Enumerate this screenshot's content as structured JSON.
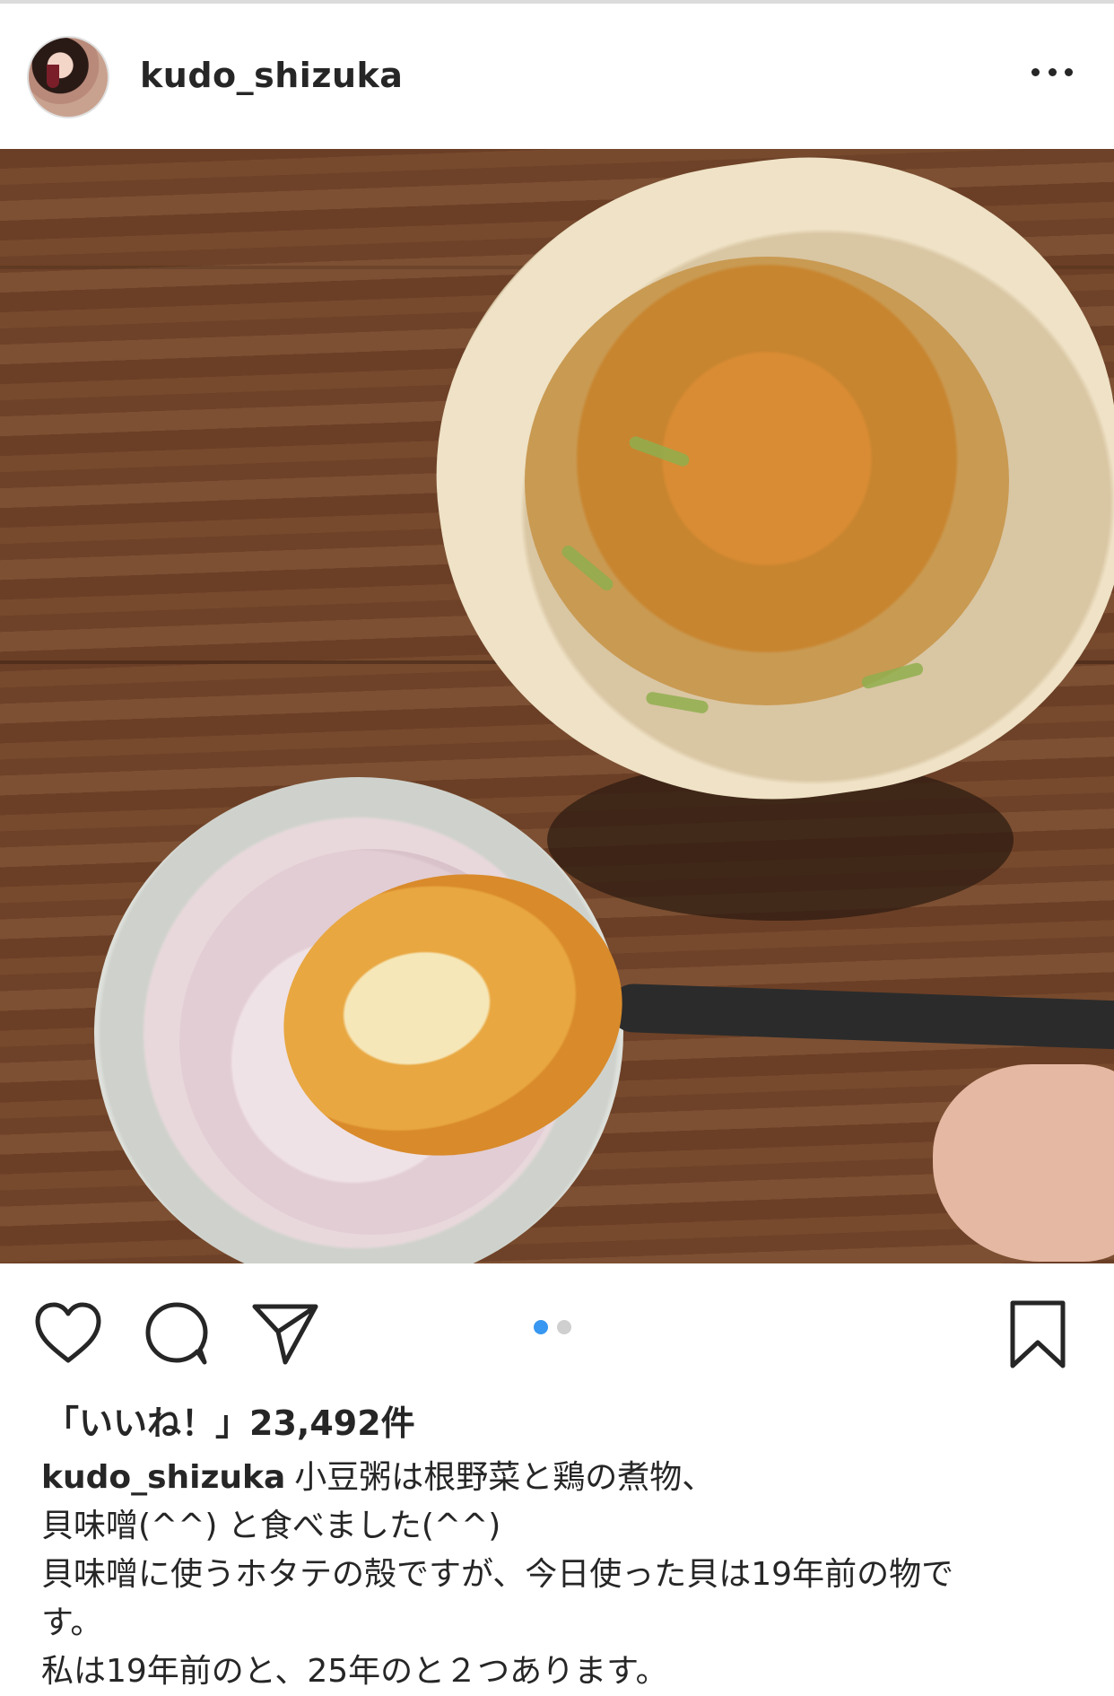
{
  "post": {
    "username": "kudo_shizuka",
    "avatar_icon": "profile-avatar",
    "more_icon": "more-horizontal-icon"
  },
  "actions": {
    "like_icon": "heart-icon",
    "comment_icon": "comment-bubble-icon",
    "share_icon": "paper-plane-icon",
    "save_icon": "bookmark-icon",
    "carousel": {
      "count": 2,
      "active_index": 0
    },
    "accent_color": "#3897f0"
  },
  "likes": {
    "text": "「いいね！」23,492件"
  },
  "caption": {
    "username": "kudo_shizuka",
    "lines": [
      "小豆粥は根野菜と鶏の煮物、",
      "貝味噌(^^) と食べました(^^)",
      "貝味噌に使うホタテの殻ですが、今日使った貝は19年前の物です。",
      "私は19年前のと、25年のと２つあります。"
    ],
    "line3_wrap": "す。",
    "line3_main": "貝味噌に使うホタテの殻ですが、今日使った貝は19年前の物で"
  }
}
